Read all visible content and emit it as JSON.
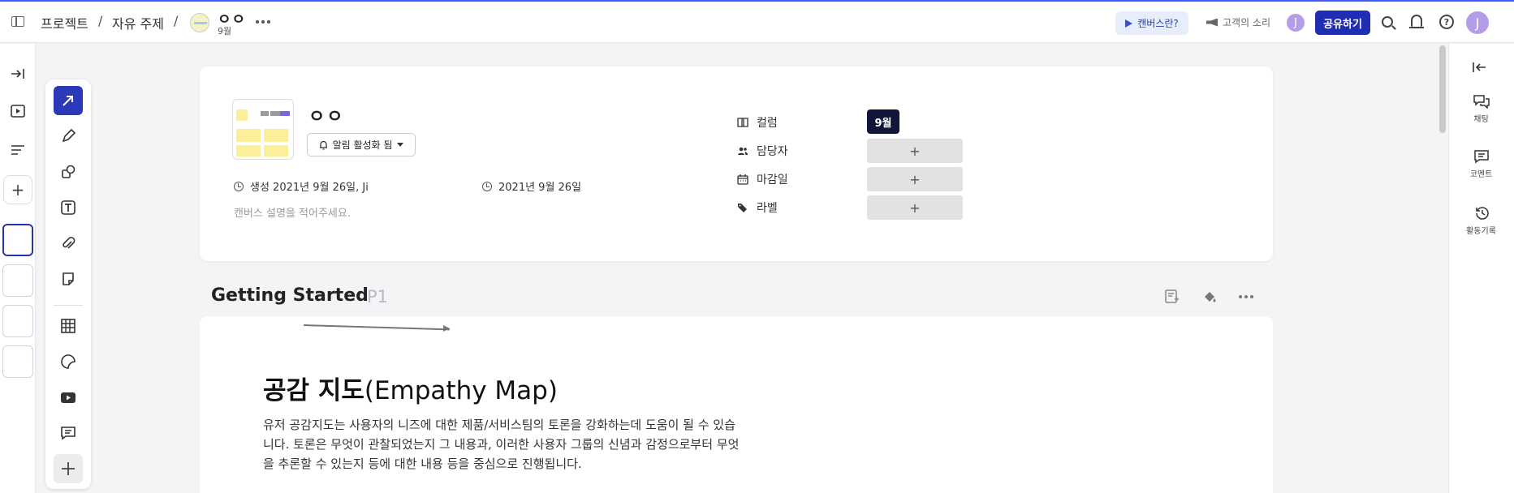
{
  "header": {
    "breadcrumb": [
      "프로젝트",
      "자유 주제"
    ],
    "canvas_title": "ㅇㅇ",
    "canvas_subtitle": "9월",
    "canvas_help": "캔버스란?",
    "customer_voice": "고객의 소리",
    "avatar_initial": "J",
    "share_label": "공유하기"
  },
  "meta": {
    "name": "ㅇㅇ",
    "notify_label": "알림 활성화 됨",
    "created": "생성 2021년 9월 26일, Ji",
    "updated": "2021년 9월 26일",
    "description_placeholder": "캔버스 설명을 적어주세요.",
    "props": {
      "column_label": "컬럼",
      "column_value": "9월",
      "assignee_label": "담당자",
      "due_label": "마감일",
      "label_label": "라벨",
      "add_symbol": "+"
    }
  },
  "section": {
    "title": "Getting Started",
    "page": "P1"
  },
  "document": {
    "title_bold": "공감 지도",
    "title_rest": "(Empathy Map)",
    "body": "유저 공감지도는 사용자의 니즈에 대한 제품/서비스팀의 토론을 강화하는데 도움이 될 수 있습니다. 토론은 무엇이 관찰되었는지 그 내용과, 이러한 사용자 그룹의 신념과 감정으로부터 무엇을 추론할 수 있는지 등에 대한 내용 등을 중심으로 진행됩니다."
  },
  "right_rail": {
    "chat": "채팅",
    "comment": "코멘트",
    "activity": "활동기록"
  },
  "icons": {
    "left_rail": [
      "expand-icon",
      "present-icon",
      "outline-icon",
      "add-page-icon"
    ],
    "toolbar": [
      "select-arrow-icon",
      "pen-icon",
      "shapes-icon",
      "text-icon",
      "attach-icon",
      "sticky-note-icon",
      "table-icon",
      "sticker-icon",
      "video-icon",
      "comment-icon",
      "add-icon"
    ]
  },
  "colors": {
    "accent": "#2a3ab8",
    "share_button": "#1f2db3",
    "column_chip": "#101539",
    "avatar": "#b49de8"
  }
}
